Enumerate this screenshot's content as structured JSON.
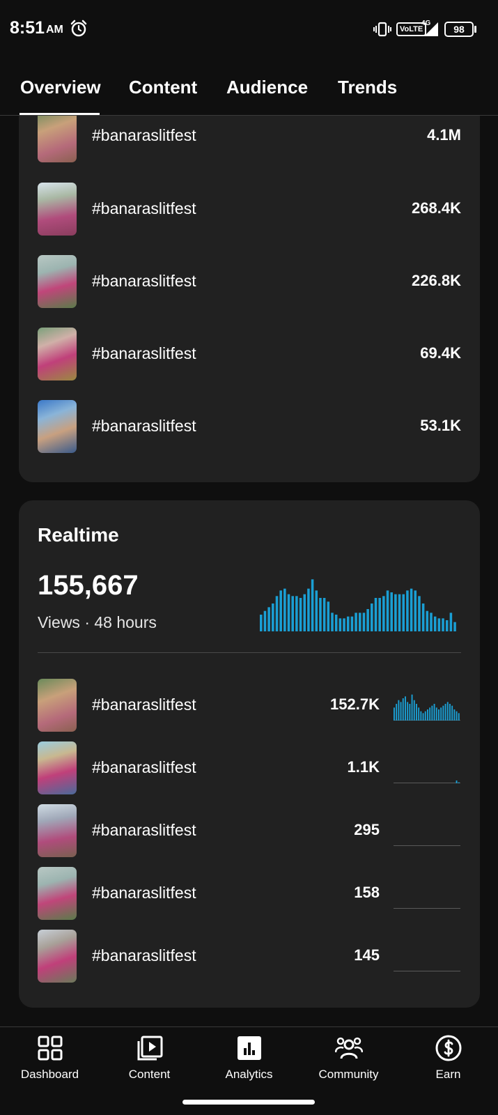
{
  "status_bar": {
    "time": "8:51",
    "ampm": "AM",
    "volte": "VoLTE",
    "network": "4G",
    "battery": "98"
  },
  "tabs": [
    {
      "label": "Overview",
      "active": true
    },
    {
      "label": "Content",
      "active": false
    },
    {
      "label": "Audience",
      "active": false
    },
    {
      "label": "Trends",
      "active": false
    }
  ],
  "top_content": {
    "items": [
      {
        "title": "#banaraslitfest",
        "value": "4.1M"
      },
      {
        "title": "#banaraslitfest",
        "value": "268.4K"
      },
      {
        "title": "#banaraslitfest",
        "value": "226.8K"
      },
      {
        "title": "#banaraslitfest",
        "value": "69.4K"
      },
      {
        "title": "#banaraslitfest",
        "value": "53.1K"
      }
    ]
  },
  "realtime": {
    "title": "Realtime",
    "views": "155,667",
    "caption": "Views · 48 hours",
    "accent_color": "#1a9fd4",
    "bars": [
      18,
      22,
      26,
      30,
      38,
      44,
      46,
      40,
      38,
      38,
      36,
      40,
      46,
      56,
      44,
      36,
      36,
      32,
      20,
      18,
      14,
      14,
      16,
      16,
      20,
      20,
      20,
      24,
      30,
      36,
      36,
      38,
      44,
      42,
      40,
      40,
      40,
      44,
      46,
      44,
      38,
      30,
      22,
      20,
      16,
      14,
      14,
      12,
      20,
      10
    ],
    "items": [
      {
        "title": "#banaraslitfest",
        "value": "152.7K",
        "spark": [
          14,
          18,
          22,
          20,
          24,
          26,
          20,
          18,
          28,
          22,
          18,
          14,
          10,
          8,
          10,
          12,
          14,
          16,
          18,
          14,
          12,
          14,
          16,
          18,
          20,
          18,
          16,
          12,
          10,
          8
        ]
      },
      {
        "title": "#banaraslitfest",
        "value": "1.1K",
        "spark": [
          0,
          0,
          0,
          0,
          0,
          0,
          0,
          0,
          0,
          0,
          0,
          0,
          0,
          0,
          0,
          0,
          0,
          0,
          0,
          0,
          0,
          0,
          0,
          0,
          0,
          0,
          0,
          0,
          3,
          1
        ]
      },
      {
        "title": "#banaraslitfest",
        "value": "295",
        "spark": [
          0,
          0,
          0,
          0,
          0,
          0,
          0,
          0,
          0,
          0,
          0,
          0,
          0,
          0,
          0,
          0,
          0,
          0,
          0,
          0,
          0,
          0,
          0,
          0,
          0,
          0,
          0,
          0,
          0,
          0
        ]
      },
      {
        "title": "#banaraslitfest",
        "value": "158",
        "spark": [
          0,
          0,
          0,
          0,
          0,
          0,
          0,
          0,
          0,
          0,
          0,
          0,
          0,
          0,
          0,
          0,
          0,
          0,
          0,
          0,
          0,
          0,
          0,
          0,
          0,
          0,
          0,
          0,
          0,
          0
        ]
      },
      {
        "title": "#banaraslitfest",
        "value": "145",
        "spark": [
          0,
          0,
          0,
          0,
          0,
          0,
          0,
          0,
          0,
          0,
          0,
          0,
          0,
          0,
          0,
          0,
          0,
          0,
          0,
          0,
          0,
          0,
          0,
          0,
          0,
          0,
          0,
          0,
          0,
          0
        ]
      }
    ]
  },
  "bottom_nav": [
    {
      "label": "Dashboard",
      "icon": "dashboard-icon"
    },
    {
      "label": "Content",
      "icon": "content-icon"
    },
    {
      "label": "Analytics",
      "icon": "analytics-icon"
    },
    {
      "label": "Community",
      "icon": "community-icon"
    },
    {
      "label": "Earn",
      "icon": "earn-icon"
    }
  ]
}
